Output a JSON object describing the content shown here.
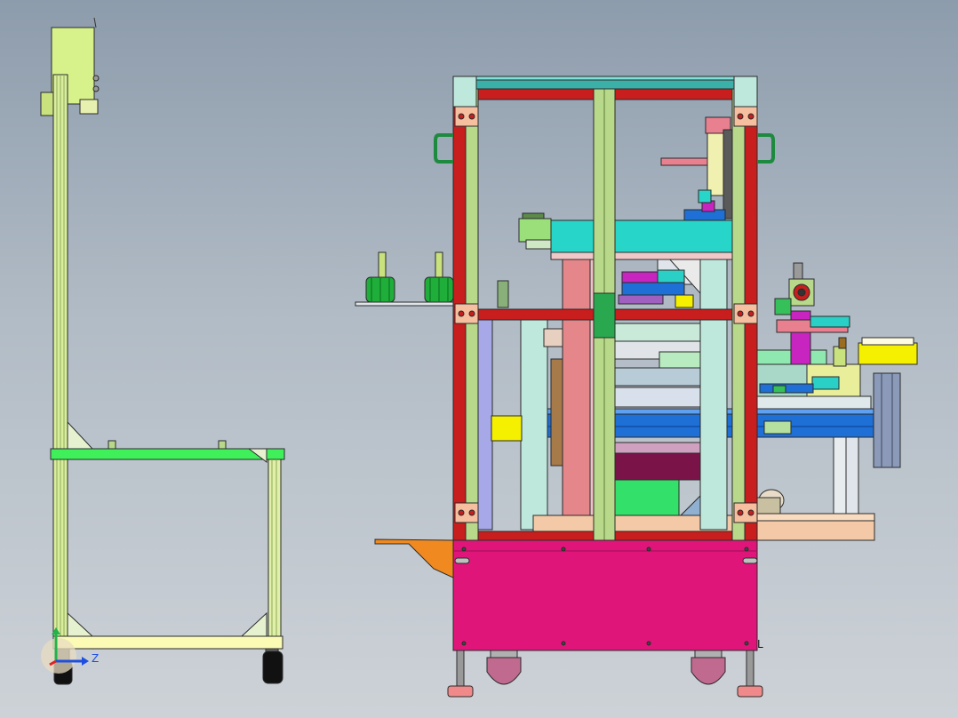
{
  "triad": {
    "x_axis": "",
    "y_axis": "",
    "z_axis": "Z"
  },
  "corner_mark": "L",
  "colors": {
    "frame_green": "#b8d98a",
    "frame_red": "#c81e1e",
    "base_magenta": "#e0157a",
    "cyan": "#27d6c8",
    "blue": "#1e6fd6",
    "salmon": "#e88080",
    "bright_green": "#33e06a",
    "yellow": "#f4f000",
    "purple": "#9a1dbf"
  }
}
